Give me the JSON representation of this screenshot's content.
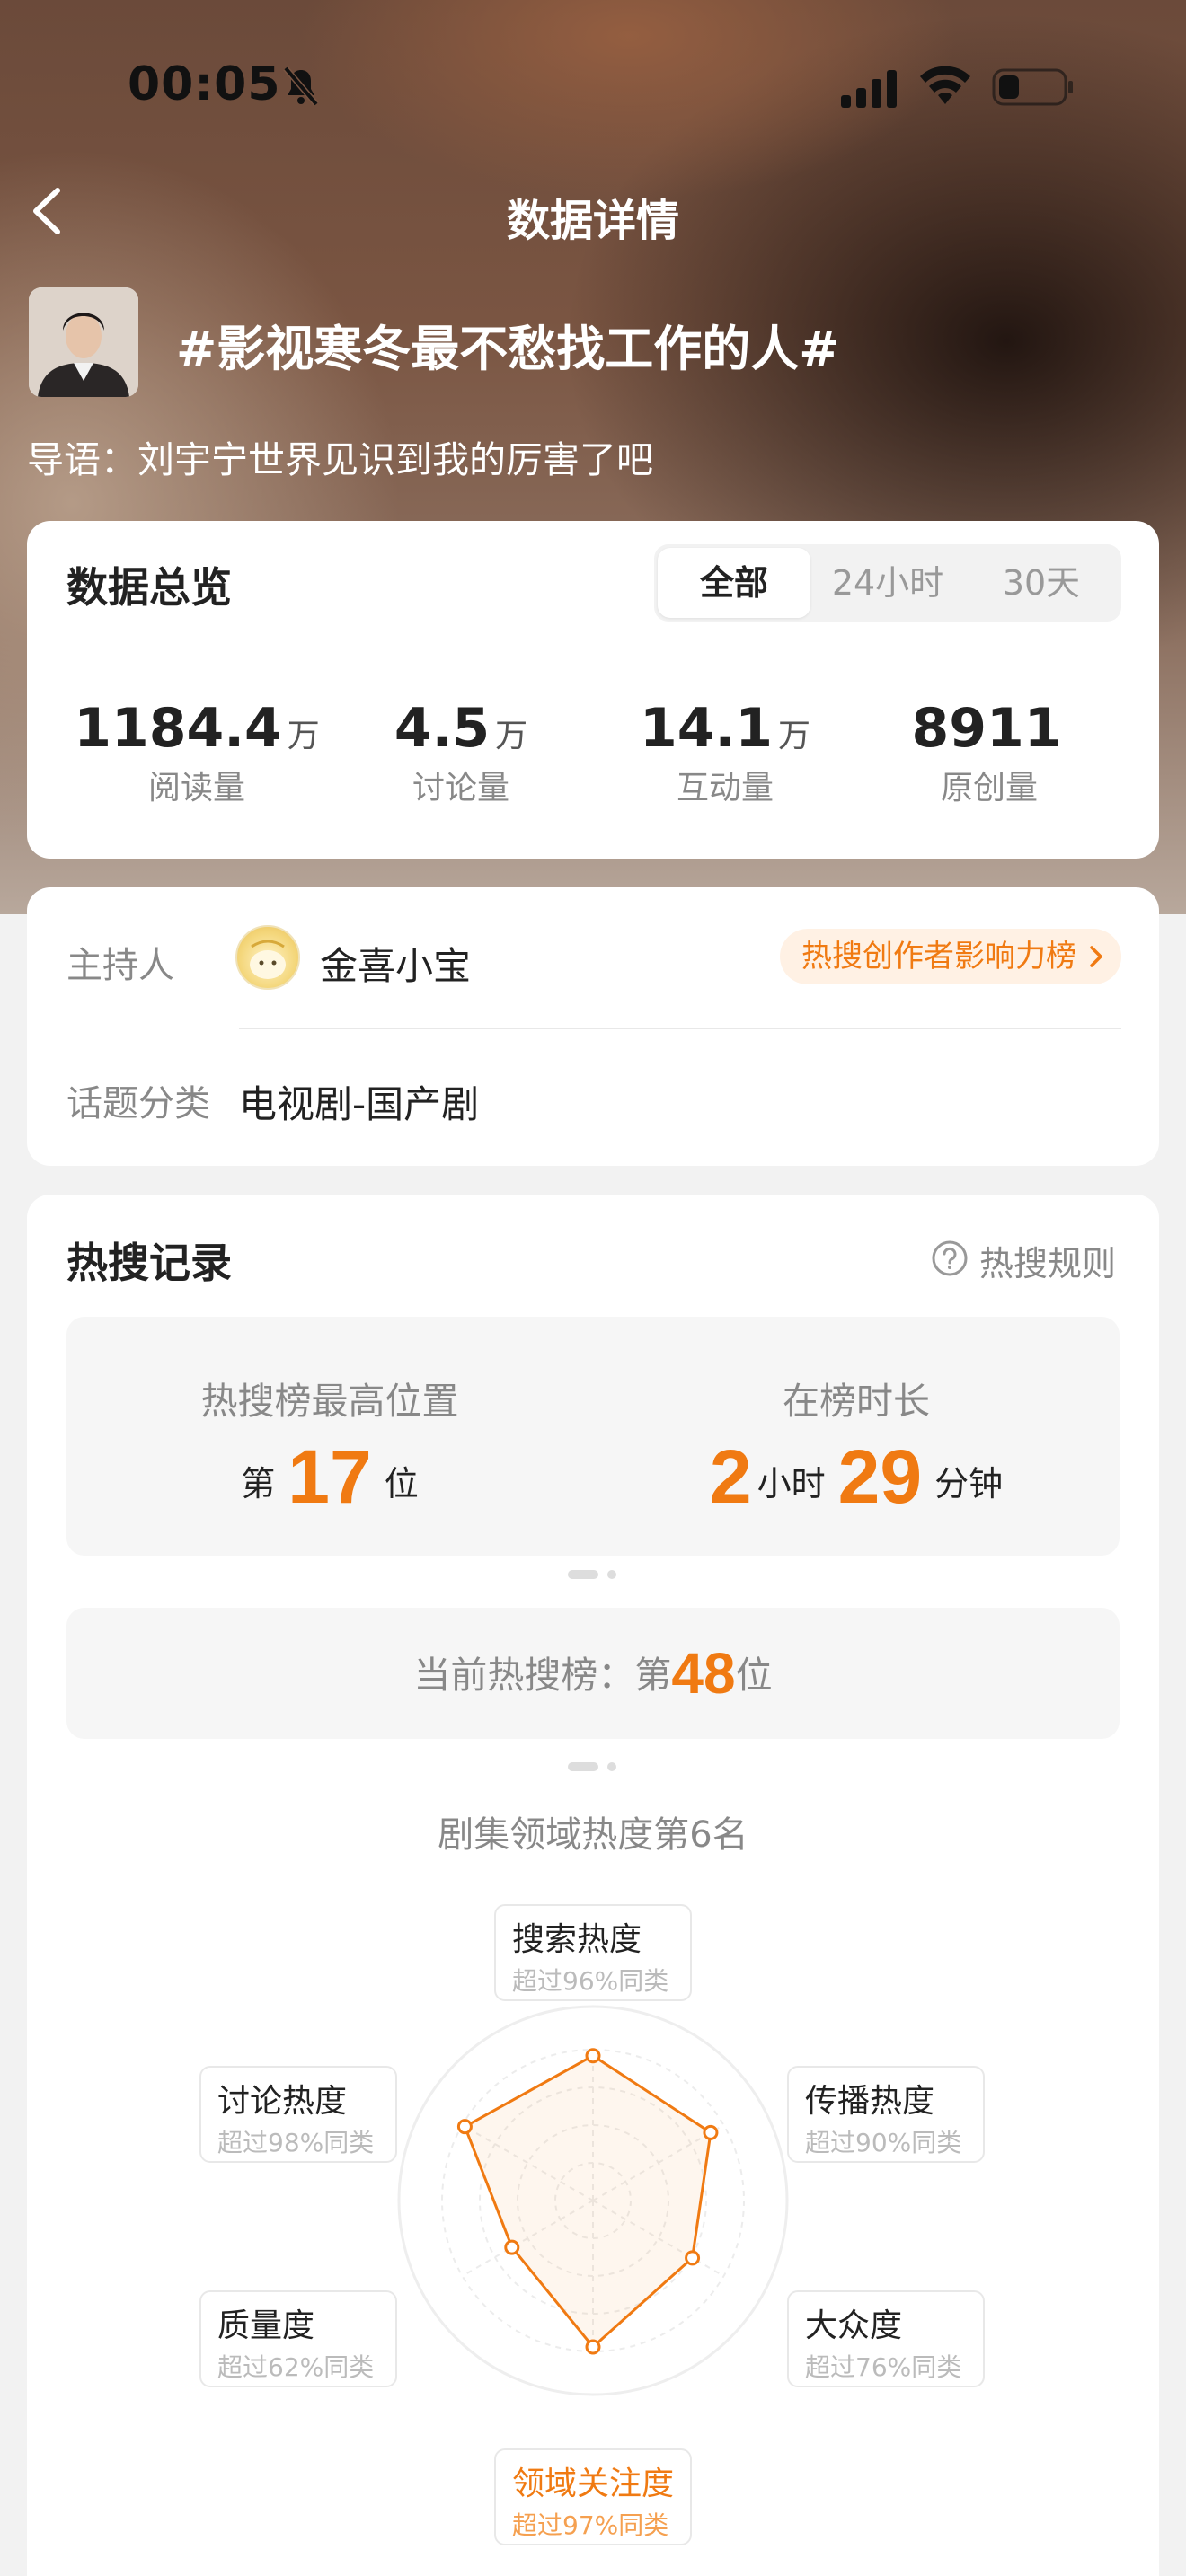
{
  "status_bar": {
    "time": "00:05"
  },
  "nav": {
    "title": "数据详情"
  },
  "topic": {
    "title": "#影视寒冬最不愁找工作的人#",
    "intro": "导语：刘宇宁世界见识到我的厉害了吧"
  },
  "overview": {
    "title": "数据总览",
    "tabs": [
      {
        "label": "全部",
        "active": true
      },
      {
        "label": "24小时",
        "active": false
      },
      {
        "label": "30天",
        "active": false
      }
    ],
    "stats": [
      {
        "value": "1184.4",
        "unit": "万",
        "label": "阅读量"
      },
      {
        "value": "4.5",
        "unit": "万",
        "label": "讨论量"
      },
      {
        "value": "14.1",
        "unit": "万",
        "label": "互动量"
      },
      {
        "value": "8911",
        "unit": "",
        "label": "原创量"
      }
    ]
  },
  "host": {
    "label": "主持人",
    "name": "金喜小宝",
    "rank_link": "热搜创作者影响力榜",
    "category_label": "话题分类",
    "category_value": "电视剧-国产剧"
  },
  "hot_record": {
    "title": "热搜记录",
    "rules": "热搜规则",
    "peak": {
      "title": "热搜榜最高位置",
      "prefix": "第",
      "value": "17",
      "suffix": "位"
    },
    "duration": {
      "title": "在榜时长",
      "hours": "2",
      "hours_unit": "小时",
      "minutes": "29",
      "minutes_unit": "分钟"
    },
    "current": {
      "label": "当前热搜榜：第",
      "value": "48",
      "suffix": "位"
    }
  },
  "radar": {
    "title": "剧集领域热度第6名",
    "accent": "#f07a12",
    "axes": [
      {
        "name": "搜索热度",
        "sub": "超过96%同类",
        "value": 96,
        "highlight": false
      },
      {
        "name": "传播热度",
        "sub": "超过90%同类",
        "value": 90,
        "highlight": false
      },
      {
        "name": "大众度",
        "sub": "超过76%同类",
        "value": 76,
        "highlight": false
      },
      {
        "name": "领域关注度",
        "sub": "超过97%同类",
        "value": 97,
        "highlight": true
      },
      {
        "name": "质量度",
        "sub": "超过62%同类",
        "value": 62,
        "highlight": false
      },
      {
        "name": "讨论热度",
        "sub": "超过98%同类",
        "value": 98,
        "highlight": false
      }
    ]
  }
}
